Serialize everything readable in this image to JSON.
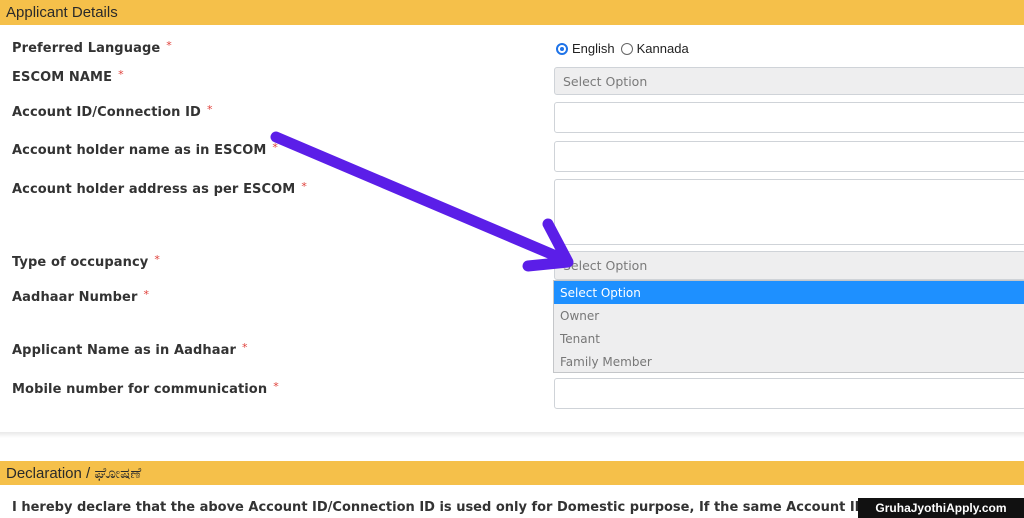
{
  "sections": {
    "applicant_details": "Applicant Details",
    "declaration": "Declaration / ಘೋಷಣೆ"
  },
  "required_marker": "*",
  "form": {
    "preferred_language": {
      "label": "Preferred Language",
      "options": [
        "English",
        "Kannada"
      ],
      "selected": "English"
    },
    "escom_name": {
      "label": "ESCOM NAME",
      "value": "Select Option"
    },
    "account_id": {
      "label": "Account ID/Connection ID",
      "value": ""
    },
    "account_holder_name": {
      "label": "Account holder name as in ESCOM",
      "value": ""
    },
    "account_holder_address": {
      "label": "Account holder address as per ESCOM",
      "value": ""
    },
    "occupancy": {
      "label": "Type of occupancy",
      "value": "Select Option",
      "options": [
        "Select Option",
        "Owner",
        "Tenant",
        "Family Member"
      ],
      "highlighted": "Select Option"
    },
    "aadhaar_number": {
      "label": "Aadhaar Number"
    },
    "applicant_name": {
      "label": "Applicant Name as in Aadhaar"
    },
    "mobile_number": {
      "label": "Mobile number for communication",
      "value": ""
    }
  },
  "declaration_text": "I hereby declare that the above Account ID/Connection ID is used only for Domestic purpose, If the same Account ID/Connection ID",
  "watermark": "GruhaJyothiApply.com",
  "colors": {
    "section_header": "#f5c04a",
    "required": "#e0403a",
    "selection_highlight": "#1e90ff",
    "annotation_arrow": "#5b1ee8"
  }
}
